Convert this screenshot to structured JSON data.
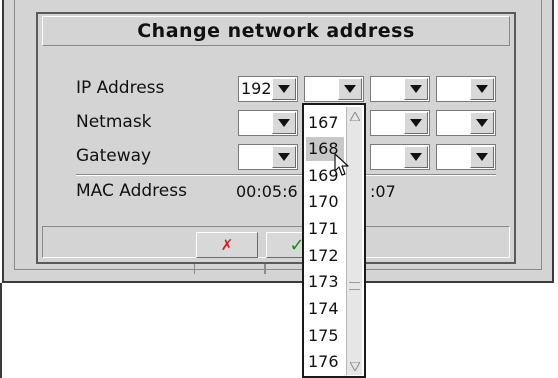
{
  "dialog": {
    "title": "Change network address",
    "fields": {
      "ip_label": "IP Address",
      "netmask_label": "Netmask",
      "gateway_label": "Gateway",
      "mac_label": "MAC Address"
    },
    "ip": {
      "octet1": "192",
      "octet2": "",
      "octet3": "",
      "octet4": ""
    },
    "netmask": {
      "octet1": "",
      "octet2": "",
      "octet3": "",
      "octet4": ""
    },
    "gateway": {
      "octet1": "",
      "octet2": "",
      "octet3": "",
      "octet4": ""
    },
    "mac_value_left": "00:05:6",
    "mac_value_right": ":07",
    "cancel_glyph": "✗",
    "ok_glyph": "✓"
  },
  "dropdown": {
    "items": [
      "167",
      "168",
      "169",
      "170",
      "171",
      "172",
      "173",
      "174",
      "175",
      "176"
    ],
    "selected_value": "168"
  },
  "icons": {
    "combo_button": "triangle-down-icon",
    "cancel": "cross-icon",
    "ok": "check-icon",
    "scroll_up": "scroll-up-icon",
    "scroll_down": "scroll-down-icon",
    "pointer": "mouse-pointer-icon"
  },
  "colors": {
    "cancel": "#d21f1f",
    "ok": "#1a8a1a",
    "dialog_bg": "#d4d4d4"
  }
}
